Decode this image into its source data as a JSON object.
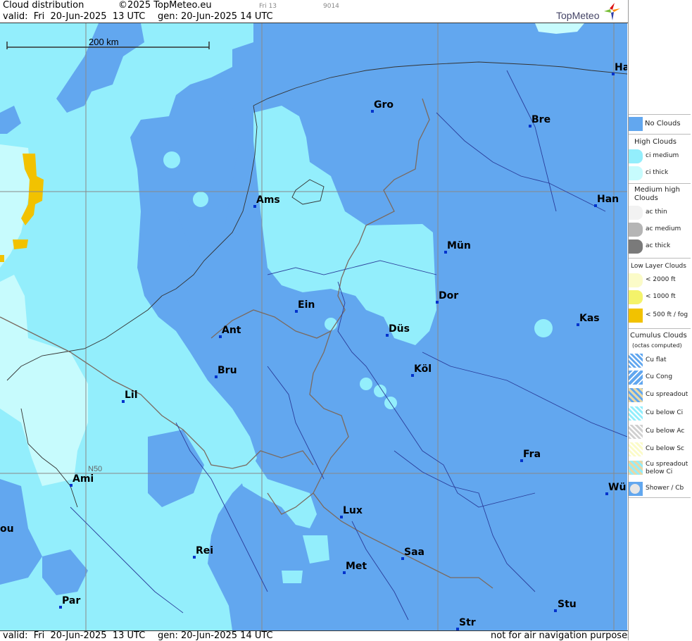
{
  "header": {
    "title": "Cloud distribution",
    "copyright": "©2025 TopMeteo.eu",
    "valid": "valid:  Fri  20-Jun-2025  13 UTC",
    "gen": "gen: 20-Jun-2025 14 UTC",
    "small_code1": "Fri 13",
    "small_code2": "9014",
    "logo_text": "TopMeteo"
  },
  "footer": {
    "valid": "valid:  Fri  20-Jun-2025  13 UTC",
    "gen": "gen: 20-Jun-2025 14 UTC",
    "disclaimer": "not for air navigation purposes"
  },
  "map": {
    "scale_label": "200 km",
    "lat_label": "N50",
    "cities": [
      {
        "name": "Gro"
      },
      {
        "name": "Bre"
      },
      {
        "name": "Ha"
      },
      {
        "name": "Ams"
      },
      {
        "name": "Han"
      },
      {
        "name": "Mün"
      },
      {
        "name": "Dor"
      },
      {
        "name": "Ein"
      },
      {
        "name": "Ant"
      },
      {
        "name": "Düs"
      },
      {
        "name": "Kas"
      },
      {
        "name": "Bru"
      },
      {
        "name": "Köl"
      },
      {
        "name": "Lil"
      },
      {
        "name": "Fra"
      },
      {
        "name": "Ami"
      },
      {
        "name": "Wü"
      },
      {
        "name": "Lux"
      },
      {
        "name": "ou"
      },
      {
        "name": "Rei"
      },
      {
        "name": "Saa"
      },
      {
        "name": "Met"
      },
      {
        "name": "Par"
      },
      {
        "name": "Stu"
      },
      {
        "name": "Str"
      }
    ]
  },
  "legend": {
    "no_clouds": "No Clouds",
    "high_clouds": "High Clouds",
    "ci_medium": "ci medium",
    "ci_thick": "ci thick",
    "medium_high": "Medium high Clouds",
    "ac_thin": "ac thin",
    "ac_medium": "ac medium",
    "ac_thick": "ac thick",
    "low_layer": "Low Layer Clouds",
    "lt2000": "< 2000 ft",
    "lt1000": "< 1000 ft",
    "lt500": "< 500 ft / fog",
    "cumulus": "Cumulus Clouds",
    "octas": "(octas computed)",
    "cu_flat": "Cu flat",
    "cu_cong": "Cu Cong",
    "cu_spreadout": "Cu spreadout",
    "cu_below_ci": "Cu below Ci",
    "cu_below_ac": "Cu below Ac",
    "cu_below_sc": "Cu below Sc",
    "cu_spreadout_below_ci": "Cu spreadout below Ci",
    "shower": "Shower / Cb"
  },
  "colors": {
    "no_clouds": "#62a7ef",
    "ci_medium": "#93eefc",
    "ci_thick": "#c7fbfd",
    "border": "#7a6a60",
    "river": "#2a3d9a",
    "grid": "#888888",
    "low_fog": "#f2c200"
  }
}
